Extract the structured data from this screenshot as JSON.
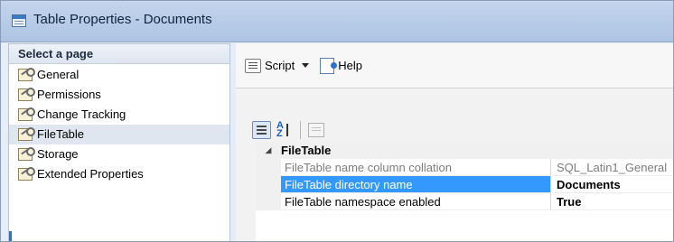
{
  "window": {
    "title": "Table Properties - Documents"
  },
  "sidebar": {
    "header": "Select a page",
    "items": [
      {
        "label": "General",
        "icon": "wrench-page-icon"
      },
      {
        "label": "Permissions",
        "icon": "wrench-page-icon"
      },
      {
        "label": "Change Tracking",
        "icon": "wrench-page-icon"
      },
      {
        "label": "FileTable",
        "icon": "wrench-page-icon",
        "selected": true
      },
      {
        "label": "Storage",
        "icon": "wrench-page-icon"
      },
      {
        "label": "Extended Properties",
        "icon": "wrench-page-icon"
      }
    ]
  },
  "toolbar": {
    "script_label": "Script",
    "help_label": "Help"
  },
  "property_grid": {
    "category": "FileTable",
    "collapse_glyph": "◢",
    "rows": [
      {
        "name": "FileTable name column collation",
        "value": "SQL_Latin1_General",
        "readonly": true
      },
      {
        "name": "FileTable directory name",
        "value": "Documents",
        "selected": true
      },
      {
        "name": "FileTable namespace enabled",
        "value": "True"
      }
    ]
  },
  "colors": {
    "selection": "#3399ff",
    "title_bar": "#b9cde8",
    "pane_background": "#f2f2f2"
  }
}
